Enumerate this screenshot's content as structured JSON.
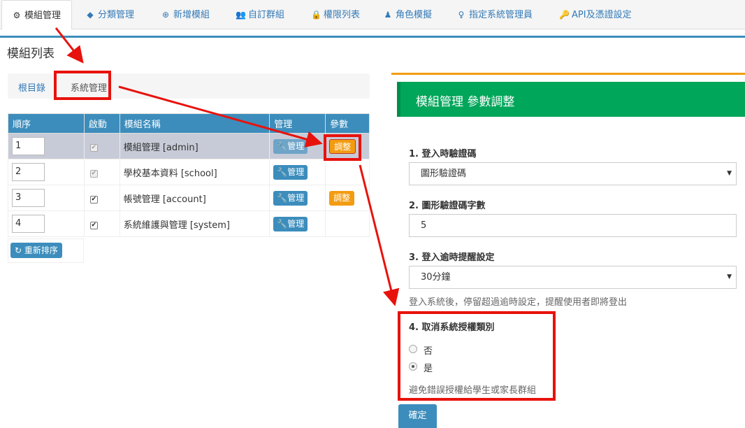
{
  "tabs": [
    {
      "icon": "gear-icon",
      "glyph": "⚙",
      "label": "模組管理"
    },
    {
      "icon": "tags-icon",
      "glyph": "◆",
      "label": "分類管理"
    },
    {
      "icon": "plus-circle-icon",
      "glyph": "⊕",
      "label": "新增模組"
    },
    {
      "icon": "users-icon",
      "glyph": "👥",
      "label": "自訂群組"
    },
    {
      "icon": "lock-icon",
      "glyph": "🔒",
      "label": "權限列表"
    },
    {
      "icon": "user-secret-icon",
      "glyph": "♟",
      "label": "角色模擬"
    },
    {
      "icon": "user-icon",
      "glyph": "♀",
      "label": "指定系統管理員"
    },
    {
      "icon": "key-icon",
      "glyph": "🔑",
      "label": "API及憑證設定"
    }
  ],
  "page_title": "模組列表",
  "breadcrumb": {
    "root": "根目錄",
    "current": "系統管理"
  },
  "table": {
    "headers": [
      "順序",
      "啟動",
      "模組名稱",
      "管理",
      "參數"
    ],
    "rows": [
      {
        "order": "1",
        "enabled": true,
        "name": "模組管理 [admin]",
        "manage": "管理",
        "param": "調整"
      },
      {
        "order": "2",
        "enabled": true,
        "name": "學校基本資料 [school]",
        "manage": "管理",
        "param": ""
      },
      {
        "order": "3",
        "enabled": true,
        "name": "帳號管理 [account]",
        "manage": "管理",
        "param": "調整"
      },
      {
        "order": "4",
        "enabled": true,
        "name": "系統維護與管理 [system]",
        "manage": "管理",
        "param": ""
      }
    ],
    "resort_label": "重新排序"
  },
  "panel": {
    "title": "模組管理 參數調整",
    "field1": {
      "label": "1. 登入時驗證碼",
      "value": "圖形驗證碼"
    },
    "field2": {
      "label": "2. 圖形驗證碼字數",
      "value": "5"
    },
    "field3": {
      "label": "3. 登入逾時提醒設定",
      "value": "30分鐘",
      "help": "登入系統後，停留超過逾時設定，提醒使用者即將登出"
    },
    "field4": {
      "label": "4. 取消系統授權類別",
      "option_no": "否",
      "option_yes": "是",
      "selected": "是",
      "help": "避免錯誤授權給學生或家長群組"
    },
    "ok_label": "確定"
  },
  "colors": {
    "primary": "#3c8dbc",
    "success": "#00a65a",
    "warning": "#f39c12",
    "annotation": "#e8120c"
  }
}
